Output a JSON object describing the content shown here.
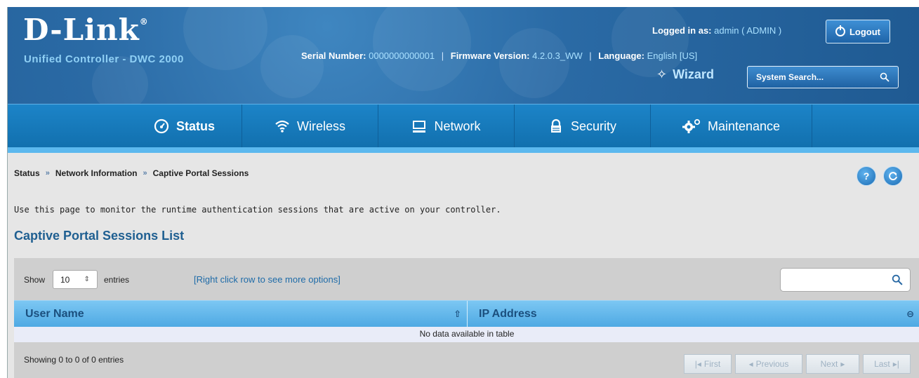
{
  "header": {
    "logo": "D-Link",
    "logo_mark": "®",
    "subtitle": "Unified Controller - DWC 2000",
    "logged_in_label": "Logged in as:",
    "logged_in_user": "admin ( ADMIN )",
    "serial_label": "Serial Number:",
    "serial_value": "0000000000001",
    "firmware_label": "Firmware Version:",
    "firmware_value": "4.2.0.3_WW",
    "language_label": "Language:",
    "language_value": "English [US]",
    "separator": "|",
    "logout_label": "Logout",
    "wizard_label": "Wizard",
    "system_search_placeholder": "System Search...",
    "icons": {
      "logout": "power-icon",
      "wizard": "wand-icon",
      "search": "search-icon"
    }
  },
  "nav": {
    "items": [
      {
        "label": "Status",
        "icon": "dashboard-icon",
        "active": true
      },
      {
        "label": "Wireless",
        "icon": "wifi-icon",
        "active": false
      },
      {
        "label": "Network",
        "icon": "computer-icon",
        "active": false
      },
      {
        "label": "Security",
        "icon": "lock-icon",
        "active": false
      },
      {
        "label": "Maintenance",
        "icon": "gear-icon",
        "active": false
      }
    ]
  },
  "breadcrumb": {
    "items": [
      "Status",
      "Network Information",
      "Captive Portal Sessions"
    ],
    "separator": "»"
  },
  "page": {
    "description": "Use this page to monitor the runtime authentication sessions that are active on your controller.",
    "section_title": "Captive Portal Sessions List",
    "help_icon_text": "?"
  },
  "table": {
    "show_label": "Show",
    "show_value": "10",
    "entries_label": "entries",
    "hint": "[Right click row to see more options]",
    "search_value": "",
    "columns": [
      "User Name",
      "IP Address"
    ],
    "empty_message": "No data available in table",
    "info": "Showing 0 to 0 of 0 entries",
    "pagination": {
      "first": "First",
      "previous": "Previous",
      "next": "Next",
      "last": "Last"
    }
  },
  "colors": {
    "header_bg": "#2a6aa5",
    "nav_bg": "#1877b8",
    "accent_light": "#5cb8ee",
    "table_header": "#5db2e8",
    "section_title": "#1f5f91"
  }
}
